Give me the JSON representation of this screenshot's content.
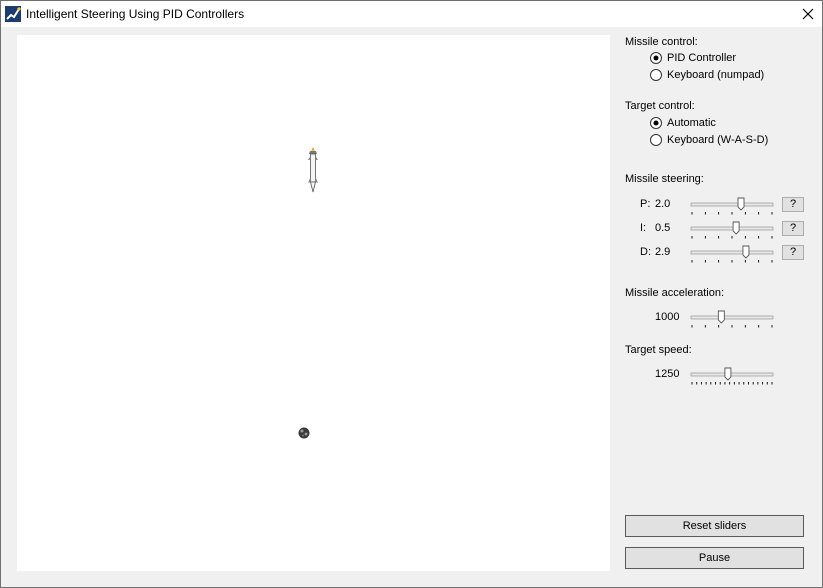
{
  "window": {
    "title": "Intelligent Steering Using PID Controllers",
    "icons": {
      "app": "app-icon",
      "close": "close-icon"
    }
  },
  "canvas": {
    "sprites": [
      "missile-icon",
      "target-icon"
    ]
  },
  "missile_control": {
    "label": "Missile control:",
    "options": [
      {
        "label": "PID Controller",
        "selected": true
      },
      {
        "label": "Keyboard (numpad)",
        "selected": false
      }
    ]
  },
  "target_control": {
    "label": "Target control:",
    "options": [
      {
        "label": "Automatic",
        "selected": true
      },
      {
        "label": "Keyboard (W-A-S-D)",
        "selected": false
      }
    ]
  },
  "missile_steering": {
    "label": "Missile steering:",
    "params": [
      {
        "name": "P:",
        "value": "2.0",
        "position": 0.61,
        "help": "?"
      },
      {
        "name": "I:",
        "value": "0.5",
        "position": 0.55,
        "help": "?"
      },
      {
        "name": "D:",
        "value": "2.9",
        "position": 0.67,
        "help": "?"
      }
    ]
  },
  "missile_acceleration": {
    "label": "Missile acceleration:",
    "value": "1000",
    "position": 0.37
  },
  "target_speed": {
    "label": "Target speed:",
    "value": "1250",
    "position": 0.45
  },
  "buttons": {
    "reset": "Reset sliders",
    "pause": "Pause"
  }
}
